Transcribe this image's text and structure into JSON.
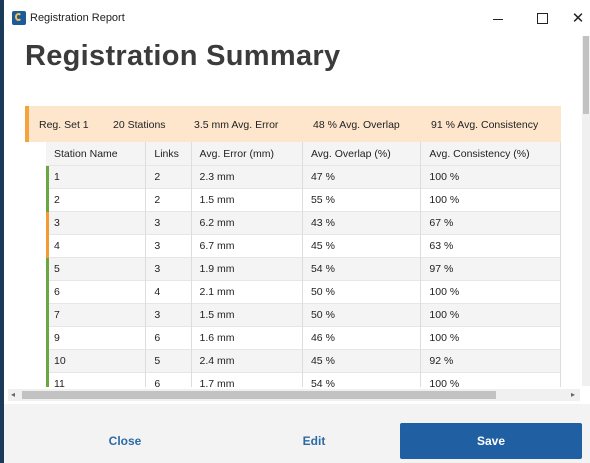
{
  "window": {
    "title": "Registration Report",
    "minimize_label": "—",
    "close_label": "✕"
  },
  "heading": "Registration Summary",
  "summary": {
    "set": "Reg. Set 1",
    "stations": "20 Stations",
    "avg_error": "3.5 mm Avg. Error",
    "avg_overlap": "48 % Avg. Overlap",
    "avg_consistency": "91 % Avg. Consistency",
    "accent_color": "#f5a23f"
  },
  "table": {
    "columns": [
      "Station Name",
      "Links",
      "Avg. Error (mm)",
      "Avg. Overlap (%)",
      "Avg. Consistency (%)"
    ],
    "rows": [
      {
        "name": "1",
        "links": "2",
        "error": "2.3 mm",
        "overlap": "47 %",
        "consistency": "100 %",
        "status": "ok"
      },
      {
        "name": "2",
        "links": "2",
        "error": "1.5 mm",
        "overlap": "55 %",
        "consistency": "100 %",
        "status": "ok"
      },
      {
        "name": "3",
        "links": "3",
        "error": "6.2 mm",
        "overlap": "43 %",
        "consistency": "67 %",
        "status": "warning"
      },
      {
        "name": "4",
        "links": "3",
        "error": "6.7 mm",
        "overlap": "45 %",
        "consistency": "63 %",
        "status": "warning"
      },
      {
        "name": "5",
        "links": "3",
        "error": "1.9 mm",
        "overlap": "54 %",
        "consistency": "97 %",
        "status": "ok"
      },
      {
        "name": "6",
        "links": "4",
        "error": "2.1 mm",
        "overlap": "50 %",
        "consistency": "100 %",
        "status": "ok"
      },
      {
        "name": "7",
        "links": "3",
        "error": "1.5 mm",
        "overlap": "50 %",
        "consistency": "100 %",
        "status": "ok"
      },
      {
        "name": "9",
        "links": "6",
        "error": "1.6 mm",
        "overlap": "46 %",
        "consistency": "100 %",
        "status": "ok"
      },
      {
        "name": "10",
        "links": "5",
        "error": "2.4 mm",
        "overlap": "45 %",
        "consistency": "92 %",
        "status": "ok"
      },
      {
        "name": "11",
        "links": "6",
        "error": "1.7 mm",
        "overlap": "54 %",
        "consistency": "100 %",
        "status": "ok"
      }
    ],
    "status_colors": {
      "ok": "#6aa640",
      "warning": "#f59a32"
    }
  },
  "footer": {
    "close_label": "Close",
    "edit_label": "Edit",
    "save_label": "Save"
  },
  "icons": {
    "app": "app-logo-icon",
    "scroll_left": "◂",
    "scroll_right": "▸"
  }
}
